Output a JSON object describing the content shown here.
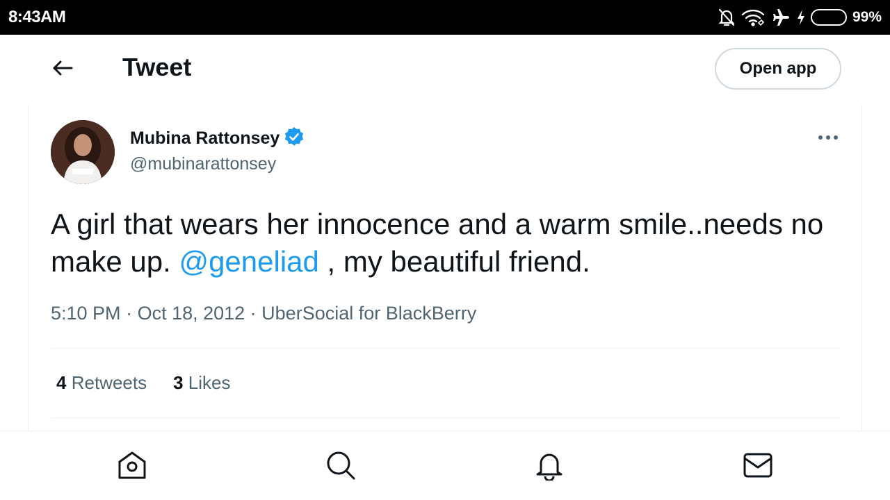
{
  "status_bar": {
    "time": "8:43AM",
    "battery_percent": "99%",
    "battery_level": 0.99,
    "icons": [
      "mute-notifications-icon",
      "wifi-icon",
      "airplane-icon",
      "charging-icon",
      "battery-icon"
    ]
  },
  "header": {
    "title": "Tweet",
    "back_icon": "back-arrow-icon",
    "open_app_label": "Open app"
  },
  "tweet": {
    "author": {
      "display_name": "Mubina Rattonsey",
      "handle": "@mubinarattonsey",
      "verified": true
    },
    "text_before_mention": "A girl that wears her innocence and a warm smile..needs no make up. ",
    "mention": "@geneliad",
    "text_after_mention": " , my beautiful friend.",
    "time": "5:10 PM",
    "separator": " · ",
    "date": "Oct 18, 2012",
    "source": "UberSocial for BlackBerry",
    "retweets_count": "4",
    "retweets_label": "Retweets",
    "likes_count": "3",
    "likes_label": "Likes"
  },
  "bottom_nav": {
    "items": [
      "home-icon",
      "search-icon",
      "notifications-icon",
      "messages-icon"
    ]
  },
  "colors": {
    "accent": "#1d9bf0",
    "text_primary": "#0f1419",
    "text_secondary": "#536471",
    "border": "#eff3f4",
    "battery": "#2ecc40"
  }
}
